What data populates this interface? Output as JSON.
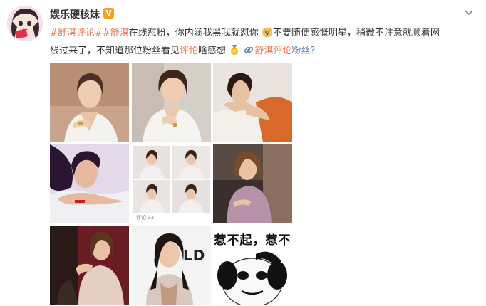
{
  "post": {
    "username": "娱乐硬核妹",
    "verified_badge": "V",
    "text_line1": {
      "topic1": "#舒淇评论#",
      "topic2": "#舒淇",
      "plain1": "在线怼粉，你内涵我黑我就怼你",
      "plain2": "不要随便感慨明星，稍微不注意就顺着网"
    },
    "text_line2": {
      "plain1": "线过来了，不知道那位粉丝看见",
      "link_word": "评论",
      "plain2": "啥感想",
      "super_topic": "舒淇评论",
      "tail": "粉丝？"
    },
    "images": {
      "thumb5_caption": "评论 33",
      "thumb8_sign": "LD",
      "meme_text": "惹不起，惹不"
    }
  },
  "colors": {
    "topic": "#eb7350",
    "link": "#5d7aa8",
    "badge": "#f7a11a"
  },
  "icons": [
    "avatar",
    "verified-badge",
    "chevron-down-icon",
    "doge-emoji",
    "gold-medal-emoji",
    "link-icon"
  ]
}
